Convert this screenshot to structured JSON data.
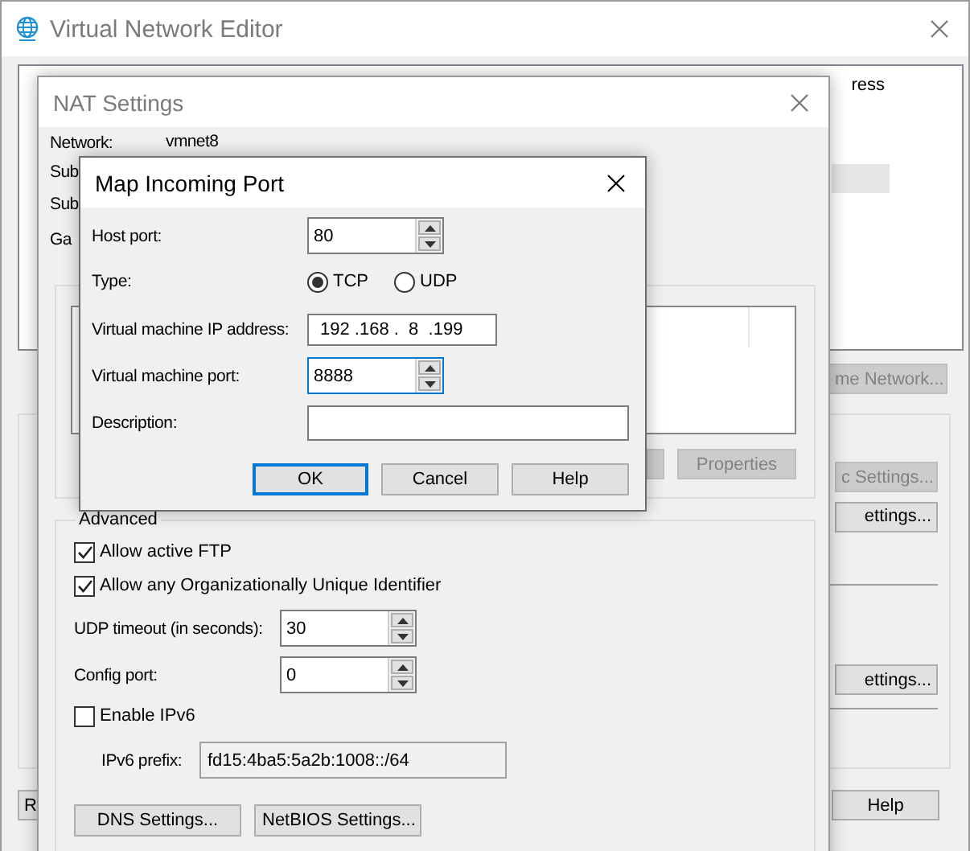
{
  "editor_window": {
    "title": "Virtual Network Editor",
    "table": {
      "columns": [
        "ress"
      ],
      "rows": [
        {
          "selected": false
        },
        {
          "selected": false
        },
        {
          "selected": true
        }
      ]
    },
    "rename_button": {
      "label": "me Network...",
      "disabled": true
    },
    "group": {
      "buttons": [
        {
          "label": "c Settings...",
          "disabled": true
        },
        {
          "label": "ettings...",
          "disabled": false
        },
        {
          "label": "ettings...",
          "disabled": false
        }
      ]
    },
    "footer_buttons": [
      {
        "label": "R",
        "disabled": false
      },
      {
        "label": "Help",
        "disabled": false
      }
    ]
  },
  "nat_window": {
    "title": "NAT Settings",
    "fields": [
      {
        "label": "Network:",
        "value": "vmnet8"
      },
      {
        "label": "Sub"
      },
      {
        "label": "Sub"
      },
      {
        "label": "Ga"
      }
    ],
    "port_forwarding": {
      "buttons": [
        {
          "disabled": true
        },
        {
          "label": "Properties",
          "disabled": true
        }
      ]
    },
    "advanced": {
      "label": "Advanced",
      "options": [
        {
          "label": "Allow active FTP",
          "checked": true
        },
        {
          "label": "Allow any Organizationally Unique Identifier",
          "checked": true
        }
      ],
      "udp_timeout": {
        "label": "UDP timeout (in seconds):",
        "value": "30"
      },
      "config_port": {
        "label": "Config port:",
        "value": "0"
      },
      "enable_ipv6": {
        "label": "Enable IPv6",
        "checked": false
      },
      "ipv6_prefix": {
        "label": "IPv6 prefix:",
        "value": "fd15:4ba5:5a2b:1008::/64",
        "disabled": true
      },
      "buttons": [
        "DNS Settings...",
        "NetBIOS Settings..."
      ]
    }
  },
  "map_dialog": {
    "title": "Map Incoming Port",
    "host_port": {
      "label": "Host port:",
      "value": "80",
      "focused": false
    },
    "type": {
      "label": "Type:",
      "options": [
        {
          "label": "TCP",
          "selected": true
        },
        {
          "label": "UDP",
          "selected": false
        }
      ]
    },
    "ip_address": {
      "label": "Virtual machine IP address:",
      "value": "192 .168 .  8  .199"
    },
    "vm_port": {
      "label": "Virtual machine port:",
      "value": "8888",
      "focused": true
    },
    "description": {
      "label": "Description:"
    },
    "buttons": [
      {
        "label": "OK",
        "default": true
      },
      {
        "label": "Cancel",
        "default": false
      },
      {
        "label": "Help",
        "default": false
      }
    ]
  }
}
